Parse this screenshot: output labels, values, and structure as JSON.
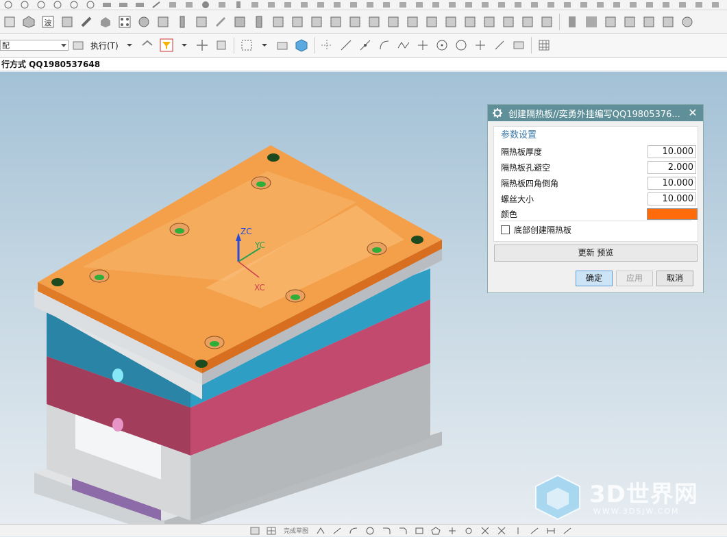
{
  "toolbar": {
    "combo_value": "配",
    "execute_label": "执行(T)"
  },
  "status": {
    "text": "行方式  QQ1980537648"
  },
  "bottombar": {
    "label": "完成草图"
  },
  "dialog": {
    "title": "创建隔热板//奕勇外挂编写QQ19805376...",
    "close": "✕",
    "group_title": "参数设置",
    "fields": [
      {
        "label": "隔热板厚度",
        "value": "10.000"
      },
      {
        "label": "隔热板孔避空",
        "value": "2.000"
      },
      {
        "label": "隔热板四角倒角",
        "value": "10.000"
      },
      {
        "label": "螺丝大小",
        "value": "10.000"
      }
    ],
    "color_label": "颜色",
    "color_value": "#ff6a0a",
    "checkbox_label": "底部创建隔热板",
    "checkbox_checked": false,
    "update_preview": "更新   预览",
    "ok": "确定",
    "apply": "应用",
    "cancel": "取消"
  },
  "axes": {
    "zc": "ZC",
    "yc": "YC",
    "xc": "XC"
  },
  "watermark": {
    "main": "3D世界网",
    "sub": "WWW.3DSJW.COM"
  },
  "colors": {
    "plate": "#f4a04a",
    "teal_block": "#2e9ec4",
    "pink_block": "#c24a6e",
    "grey_block": "#d9dada"
  }
}
